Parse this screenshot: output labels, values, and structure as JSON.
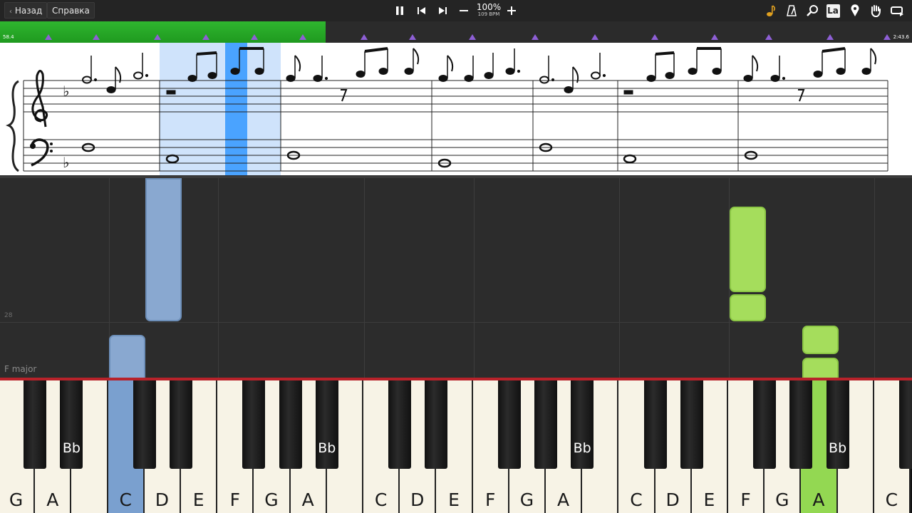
{
  "toolbar": {
    "back_label": "Назад",
    "help_label": "Справка",
    "tempo_percent": "100%",
    "tempo_bpm": "109 BPM"
  },
  "icons": [
    "pause-icon",
    "prev-icon",
    "next-icon",
    "minus-icon",
    "plus-icon",
    "note-icon",
    "metronome-icon",
    "search-icon",
    "label-icon",
    "pin-icon",
    "hand-icon",
    "loop-icon"
  ],
  "label_icon_text": "La",
  "timeline": {
    "start_time": "58.4",
    "end_time": "2:43.6",
    "progress": 0.357
  },
  "roll": {
    "key_label": "F major",
    "measure_number": "28"
  },
  "keyboard": {
    "white_keys": [
      "G",
      "A",
      "",
      "C",
      "D",
      "E",
      "F",
      "G",
      "A",
      "",
      "C",
      "D",
      "E",
      "F",
      "G",
      "A",
      "",
      "C",
      "D",
      "E",
      "F",
      "G",
      "A",
      "",
      "C"
    ],
    "black_label": "Bb"
  },
  "colors": {
    "progress": "#2fb52f",
    "blue_note": "#89a8d0",
    "green_note": "#a5dd5c",
    "highlight": "#4aa3ff"
  }
}
